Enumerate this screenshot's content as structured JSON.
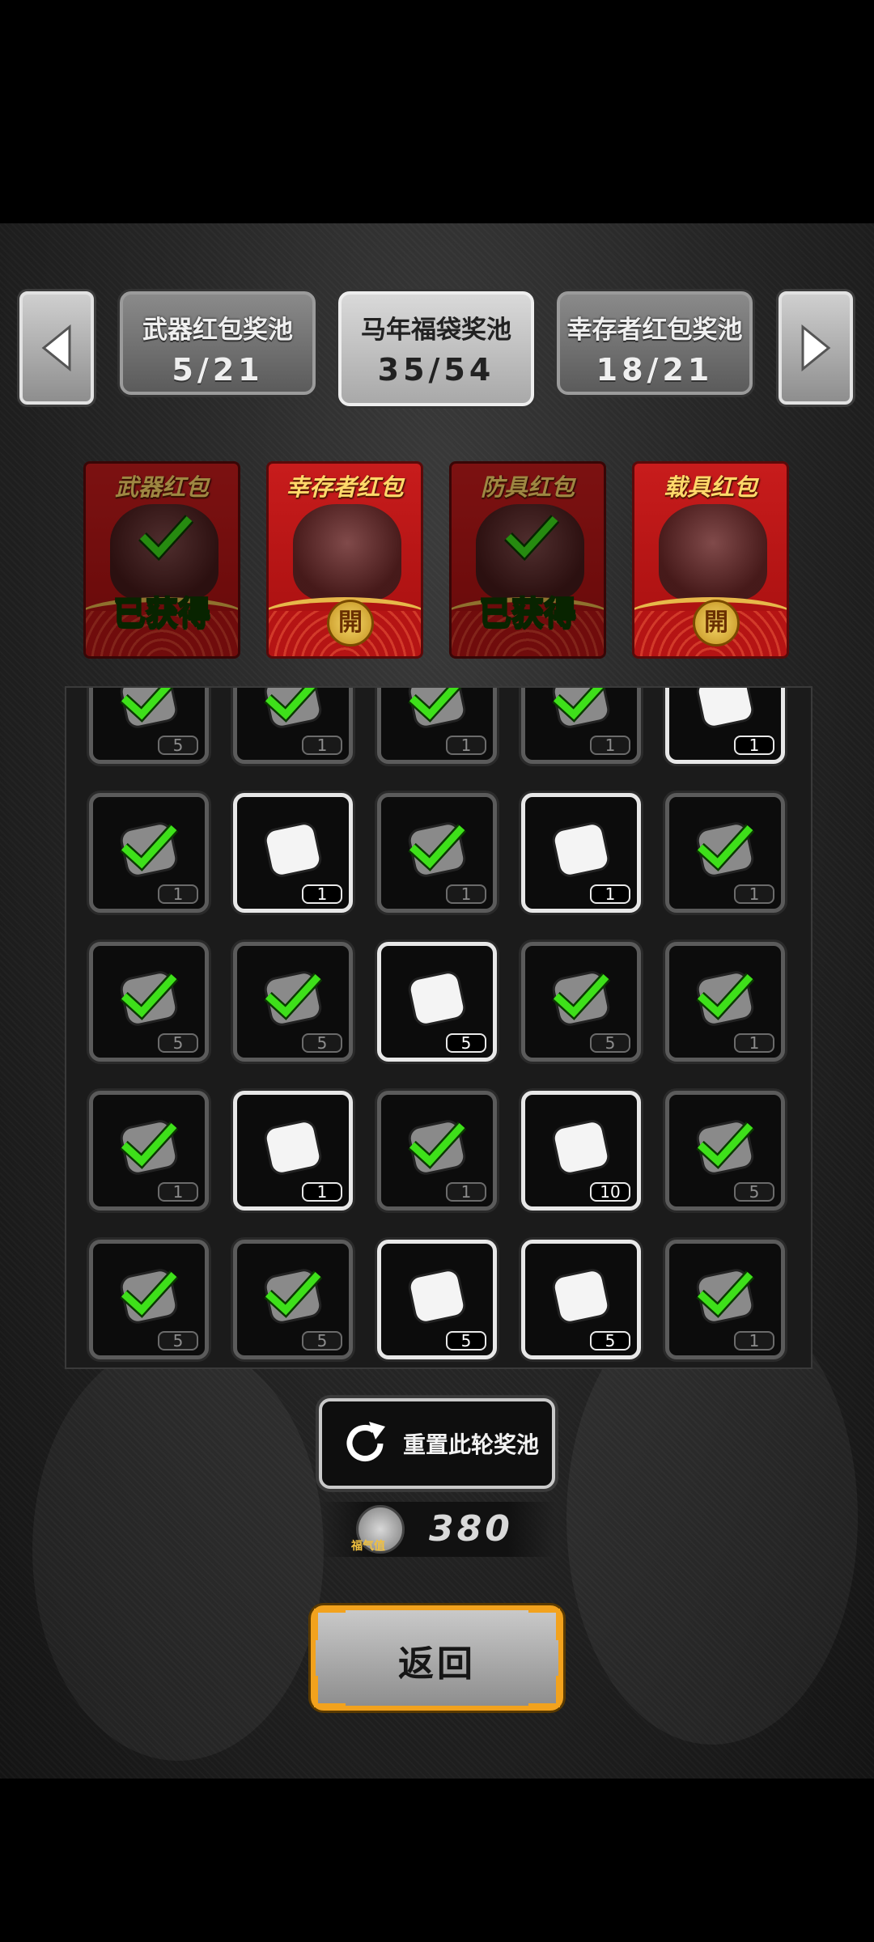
{
  "nav": {
    "prev_icon": "left-arrow-icon",
    "next_icon": "right-arrow-icon"
  },
  "pools": [
    {
      "label": "武器红包奖池",
      "count": "5/21",
      "active": false
    },
    {
      "label": "马年福袋奖池",
      "count": "35/54",
      "active": true
    },
    {
      "label": "幸存者红包奖池",
      "count": "18/21",
      "active": false
    }
  ],
  "envelopes": [
    {
      "title": "武器红包",
      "status": "已获得",
      "obtained": true
    },
    {
      "title": "幸存者红包",
      "seal": "開",
      "obtained": false
    },
    {
      "title": "防具红包",
      "status": "已获得",
      "obtained": true
    },
    {
      "title": "载具红包",
      "seal": "開",
      "obtained": false
    }
  ],
  "grid": {
    "rows": [
      [
        {
          "icon": "barbed-wire-icon",
          "qty": "5",
          "obtained": true
        },
        {
          "icon": "knife-icon",
          "qty": "1",
          "obtained": true
        },
        {
          "icon": "cloth-armor-icon",
          "qty": "1",
          "obtained": true
        },
        {
          "icon": "backpack-icon",
          "qty": "1",
          "obtained": true
        },
        {
          "icon": "vest-icon",
          "qty": "1",
          "obtained": false
        }
      ],
      [
        {
          "icon": "boots-icon",
          "qty": "1",
          "obtained": true
        },
        {
          "icon": "seeds-icon",
          "qty": "1",
          "obtained": false
        },
        {
          "icon": "ointment-tube-icon",
          "qty": "1",
          "obtained": true
        },
        {
          "icon": "pill-bottles-icon",
          "qty": "1",
          "obtained": false
        },
        {
          "icon": "boots-icon",
          "qty": "1",
          "obtained": true
        }
      ],
      [
        {
          "icon": "syringe-icon",
          "qty": "5",
          "obtained": true
        },
        {
          "icon": "rocket-icon",
          "qty": "5",
          "obtained": true
        },
        {
          "icon": "grenade-icon",
          "qty": "5",
          "obtained": false
        },
        {
          "icon": "frag-grenade-icon",
          "qty": "5",
          "obtained": true
        },
        {
          "icon": "dynamite-icon",
          "qty": "1",
          "obtained": true
        }
      ],
      [
        {
          "icon": "smoke-grenade-icon",
          "qty": "1",
          "obtained": true
        },
        {
          "icon": "cloth-roll-icon",
          "qty": "1",
          "obtained": false
        },
        {
          "icon": "flare-gun-icon",
          "qty": "1",
          "obtained": true
        },
        {
          "icon": "paper-sheet-icon",
          "qty": "10",
          "obtained": false
        },
        {
          "icon": "battery-icon",
          "qty": "5",
          "obtained": true
        }
      ],
      [
        {
          "icon": "gear-part-icon",
          "qty": "5",
          "obtained": true
        },
        {
          "icon": "gun-parts-icon",
          "qty": "5",
          "obtained": true
        },
        {
          "icon": "wood-planks-icon",
          "qty": "5",
          "obtained": false
        },
        {
          "icon": "cloth-strips-icon",
          "qty": "5",
          "obtained": false
        },
        {
          "icon": "scroll-icon",
          "qty": "1",
          "obtained": true
        }
      ]
    ]
  },
  "reset": {
    "label": "重置此轮奖池",
    "icon": "refresh-icon"
  },
  "luck": {
    "icon_label": "福气值",
    "value": "380"
  },
  "back": {
    "label": "返回"
  }
}
